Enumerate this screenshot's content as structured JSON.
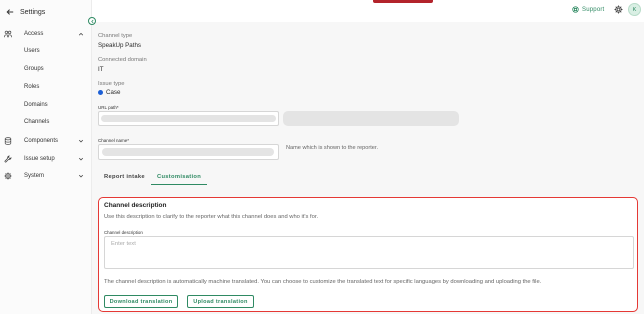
{
  "sidebar": {
    "back_label": "Settings",
    "groups": [
      {
        "label": "Access",
        "icon": "users-group-icon",
        "expanded": true,
        "items": [
          "Users",
          "Groups",
          "Roles",
          "Domains",
          "Channels"
        ]
      },
      {
        "label": "Components",
        "icon": "database-icon",
        "expanded": false
      },
      {
        "label": "Issue setup",
        "icon": "wrench-icon",
        "expanded": false
      },
      {
        "label": "System",
        "icon": "gear-icon",
        "expanded": false
      }
    ]
  },
  "topbar": {
    "support_label": "Support",
    "avatar_initial": "K",
    "accent_color": "#b3232b"
  },
  "channel": {
    "type_label": "Channel type",
    "type_value": "SpeakUp Paths",
    "domain_label": "Connected domain",
    "domain_value": "IT",
    "issue_label": "Issue type",
    "issue_value": "Case",
    "issue_color": "#1c5fd6",
    "url_label": "URL path*",
    "name_label": "Channel name*",
    "name_hint": "Name which is shown to the reporter."
  },
  "tabs": [
    {
      "label": "Report intake",
      "active": false
    },
    {
      "label": "Customisation",
      "active": true
    }
  ],
  "customisation": {
    "title": "Channel description",
    "description": "Use this description to clarify to the reporter what this channel does and who it's for.",
    "field_label": "Channel description",
    "placeholder": "Enter text",
    "note": "The channel description is automatically machine translated. You can choose to customize the translated text for specific languages by downloading and uploading the file.",
    "download_label": "Download translation",
    "upload_label": "Upload translation",
    "highlight_color": "#e53935"
  },
  "colors": {
    "accent": "#2f8a63"
  }
}
